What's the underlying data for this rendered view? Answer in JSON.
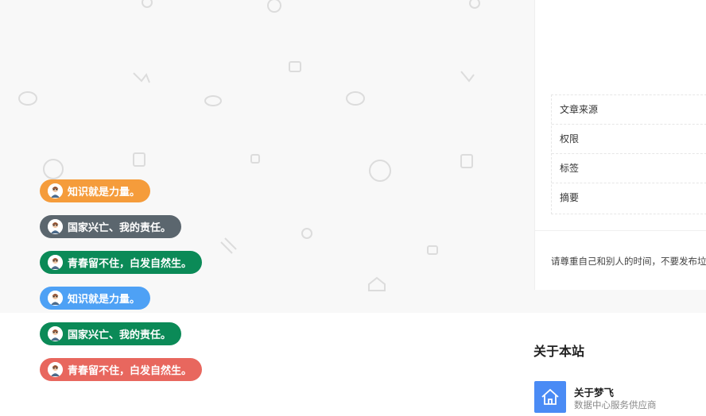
{
  "info_card": {
    "meta_rows": [
      "文章来源",
      "权限",
      "标签",
      "摘要"
    ],
    "notice": "请尊重自己和别人的时间，不要发布垃"
  },
  "tags": [
    {
      "label": "知识就是力量。",
      "color": "#f59c3b"
    },
    {
      "label": "国家兴亡、我的责任。",
      "color": "#5b666e"
    },
    {
      "label": "青春留不住，白发自然生。",
      "color": "#0b8a57"
    },
    {
      "label": "知识就是力量。",
      "color": "#4ea1f5"
    },
    {
      "label": "国家兴亡、我的责任。",
      "color": "#0b8a57"
    },
    {
      "label": "青春留不住，白发自然生。",
      "color": "#e8675e"
    }
  ],
  "about": {
    "title": "关于本站",
    "site_name": "关于梦飞",
    "site_desc": "数据中心服务供应商",
    "logo_color": "#4a8bf5"
  },
  "icons": {
    "pattern": "doodle-pattern-icon",
    "avatar": "avatar-icon",
    "logo": "home-icon"
  }
}
